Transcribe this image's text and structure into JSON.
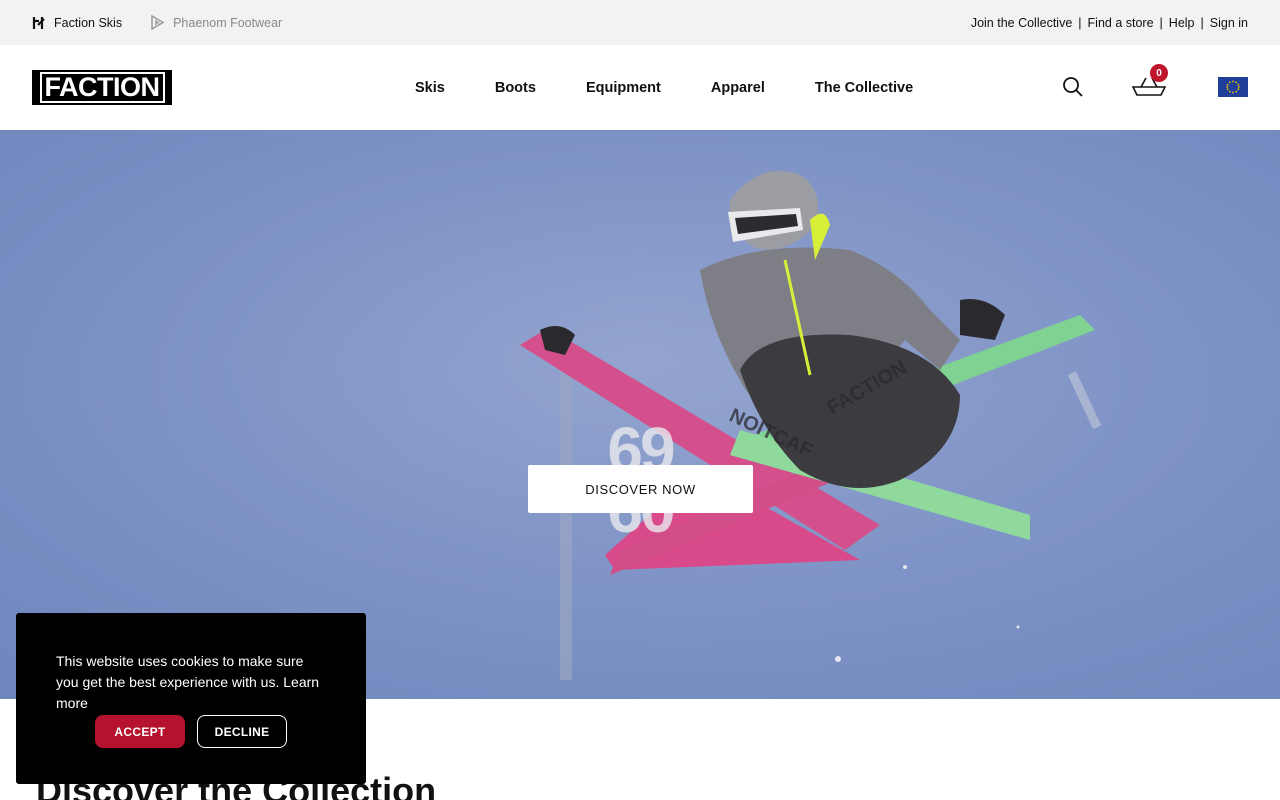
{
  "topbar": {
    "brands": [
      {
        "label": "Faction Skis",
        "icon": "faction-mark-icon"
      },
      {
        "label": "Phaenom Footwear",
        "icon": "phaenom-mark-icon"
      }
    ],
    "links": [
      "Join the Collective",
      "Find a store",
      "Help",
      "Sign in"
    ],
    "separator": "|"
  },
  "header": {
    "logo": "FACTION",
    "nav": [
      "Skis",
      "Boots",
      "Equipment",
      "Apparel",
      "The Collective"
    ],
    "search_icon": "search-icon",
    "cart_icon": "cart-icon",
    "cart_count": "0",
    "region_icon": "eu-flag-icon"
  },
  "hero": {
    "numbers_top": "69",
    "numbers_bottom": "60",
    "cta": "DISCOVER NOW"
  },
  "section": {
    "title": "Discover the Collection"
  },
  "cookie": {
    "text": "This website uses cookies to make sure you get the best experience with us.",
    "learn_more": "Learn more",
    "accept": "ACCEPT",
    "decline": "DECLINE"
  },
  "colors": {
    "accent_red": "#b5122e",
    "badge_red": "#c0162c",
    "hero_sky": "#7f94c7",
    "topbar_bg": "#f2f2f2"
  }
}
